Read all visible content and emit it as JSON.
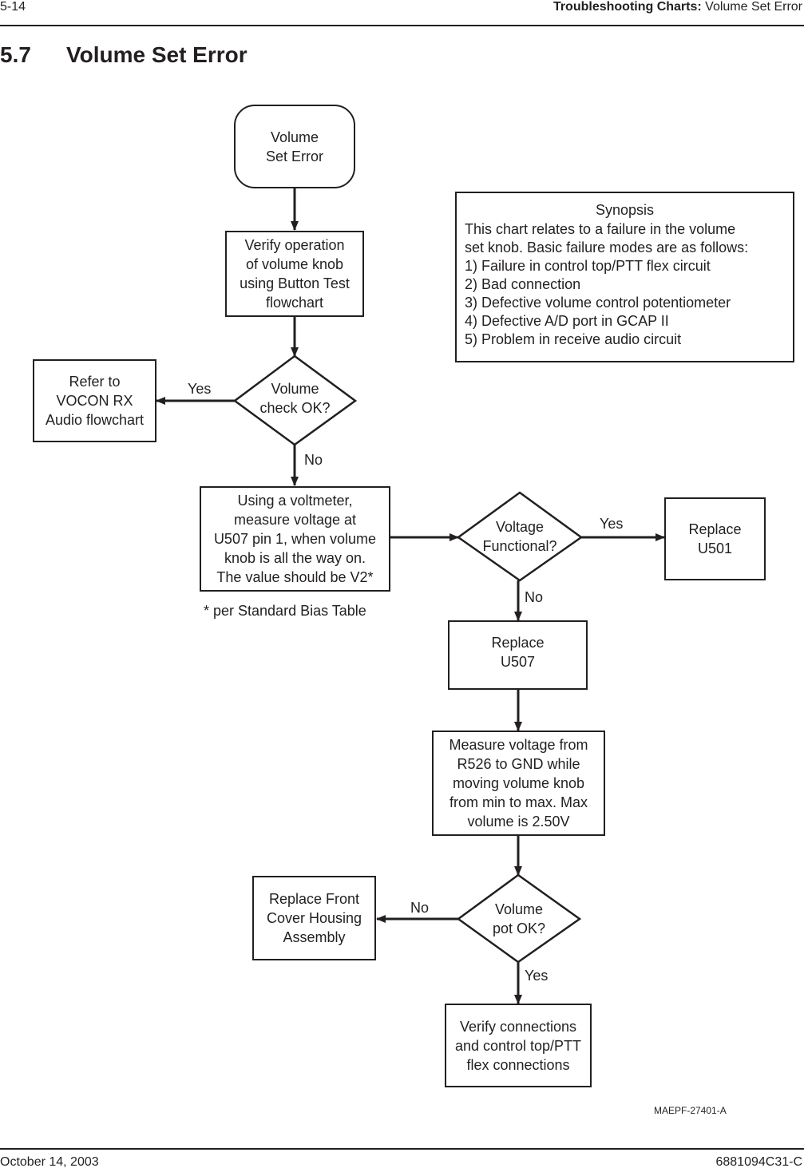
{
  "page_header": {
    "page_number": "5-14",
    "section_bold": "Troubleshooting Charts:",
    "section_name": " Volume Set Error"
  },
  "section": {
    "number": "5.7",
    "title": "Volume Set Error"
  },
  "flowchart": {
    "start": "Volume\nSet Error",
    "verify_operation": "Verify operation\nof volume knob\nusing Button Test\nflowchart",
    "decision_volume_check": "Volume\ncheck OK?",
    "refer_vocon": "Refer to\nVOCON RX\nAudio flowchart",
    "measure_u507": "Using a voltmeter,\nmeasure voltage at\nU507 pin 1, when volume\nknob is all the way on.\nThe value should be V2*",
    "footnote": "* per Standard Bias Table",
    "decision_voltage_functional": "Voltage\nFunctional?",
    "replace_u501": "Replace\nU501",
    "replace_u507": "Replace\nU507",
    "measure_r526": "Measure voltage from\nR526 to GND while\nmoving volume knob\nfrom min to max. Max\nvolume is 2.50V",
    "decision_volume_pot": "Volume\npot OK?",
    "replace_front_cover": "Replace Front\nCover Housing\nAssembly",
    "verify_connections": "Verify connections\nand control top/PTT\nflex connections",
    "labels": {
      "yes": "Yes",
      "no": "No"
    },
    "figure_id": "MAEPF-27401-A"
  },
  "synopsis": {
    "title": "Synopsis",
    "lines": [
      "This chart relates to a failure in the volume",
      "set knob. Basic failure modes are as follows:",
      "1) Failure in control top/PTT flex circuit",
      "2) Bad connection",
      "3) Defective volume control potentiometer",
      "4) Defective A/D port in GCAP II",
      "5) Problem in receive audio circuit"
    ]
  },
  "page_footer": {
    "date": "October 14, 2003",
    "doc_number": "6881094C31-C"
  }
}
